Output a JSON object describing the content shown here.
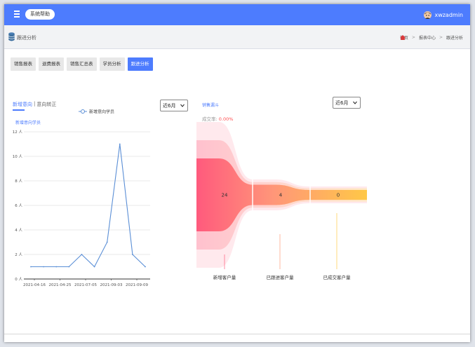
{
  "header": {
    "help_label": "系统帮助",
    "user_name": "xwzadmin"
  },
  "subheader": {
    "title": "跟进分析",
    "breadcrumb": [
      "首页",
      "报表中心",
      "跟进分析"
    ]
  },
  "tabs": [
    "销售报表",
    "退费报表",
    "销售汇总表",
    "学员分析",
    "跟进分析"
  ],
  "active_tab": 4,
  "left_panel": {
    "tab_active": "新增意向",
    "tab_inactive": "意向转正",
    "separator": "|",
    "period_select": "近6月"
  },
  "right_panel": {
    "title": "销售漏斗",
    "conv_label": "成交率:",
    "conv_value": "0.00%",
    "period_select": "近6月"
  },
  "chart_data": [
    {
      "type": "line",
      "title": "",
      "ylabel": "新增意向学员",
      "series": [
        {
          "name": "新增意向学员",
          "values": [
            1,
            1,
            1,
            1,
            2,
            1,
            3,
            11,
            2,
            1
          ]
        }
      ],
      "x_tick_labels": [
        "2021-04-16",
        "2021-04-25",
        "2021-07-05",
        "2021-09-03",
        "2021-09-09"
      ],
      "y_ticks": [
        "0 人",
        "2 人",
        "4 人",
        "6 人",
        "8 人",
        "10 人",
        "12 人"
      ],
      "ylim": [
        0,
        12
      ],
      "grid": true,
      "legend": "top-center",
      "colors": {
        "line": "#5b8fd6"
      }
    },
    {
      "type": "funnel",
      "categories": [
        "新增客户量",
        "已跟进客户量",
        "已成交客户量"
      ],
      "values": [
        24,
        4,
        0
      ],
      "colors": [
        "#ff5f7e",
        "#ff9d7a",
        "#ffc847"
      ]
    }
  ]
}
